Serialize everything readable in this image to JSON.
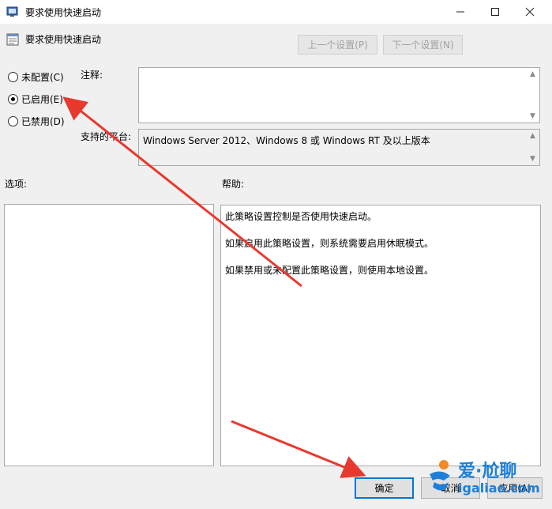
{
  "window": {
    "title": "要求使用快速启动",
    "minimize_icon": "minimize-icon",
    "maximize_icon": "maximize-icon",
    "close_icon": "close-icon"
  },
  "policy": {
    "name": "要求使用快速启动",
    "prev_button": "上一个设置(P)",
    "next_button": "下一个设置(N)"
  },
  "state": {
    "options": [
      {
        "label": "未配置(C)",
        "checked": false
      },
      {
        "label": "已启用(E)",
        "checked": true
      },
      {
        "label": "已禁用(D)",
        "checked": false
      }
    ]
  },
  "fields": {
    "comment_label": "注释:",
    "comment_value": "",
    "platform_label": "支持的平台:",
    "platform_value": "Windows Server 2012、Windows 8 或 Windows RT 及以上版本"
  },
  "panes": {
    "options_label": "选项:",
    "help_label": "帮助:",
    "help_paragraphs": [
      "此策略设置控制是否使用快速启动。",
      "如果启用此策略设置，则系统需要启用休眠模式。",
      "如果禁用或未配置此策略设置，则使用本地设置。"
    ]
  },
  "buttons": {
    "ok": "确定",
    "cancel": "取消",
    "apply": "应用(A)"
  },
  "annotation": {
    "arrow_color": "#e8392e"
  },
  "watermark": {
    "text_cn": "爱·尬聊",
    "text_url": "igaliao.com"
  }
}
